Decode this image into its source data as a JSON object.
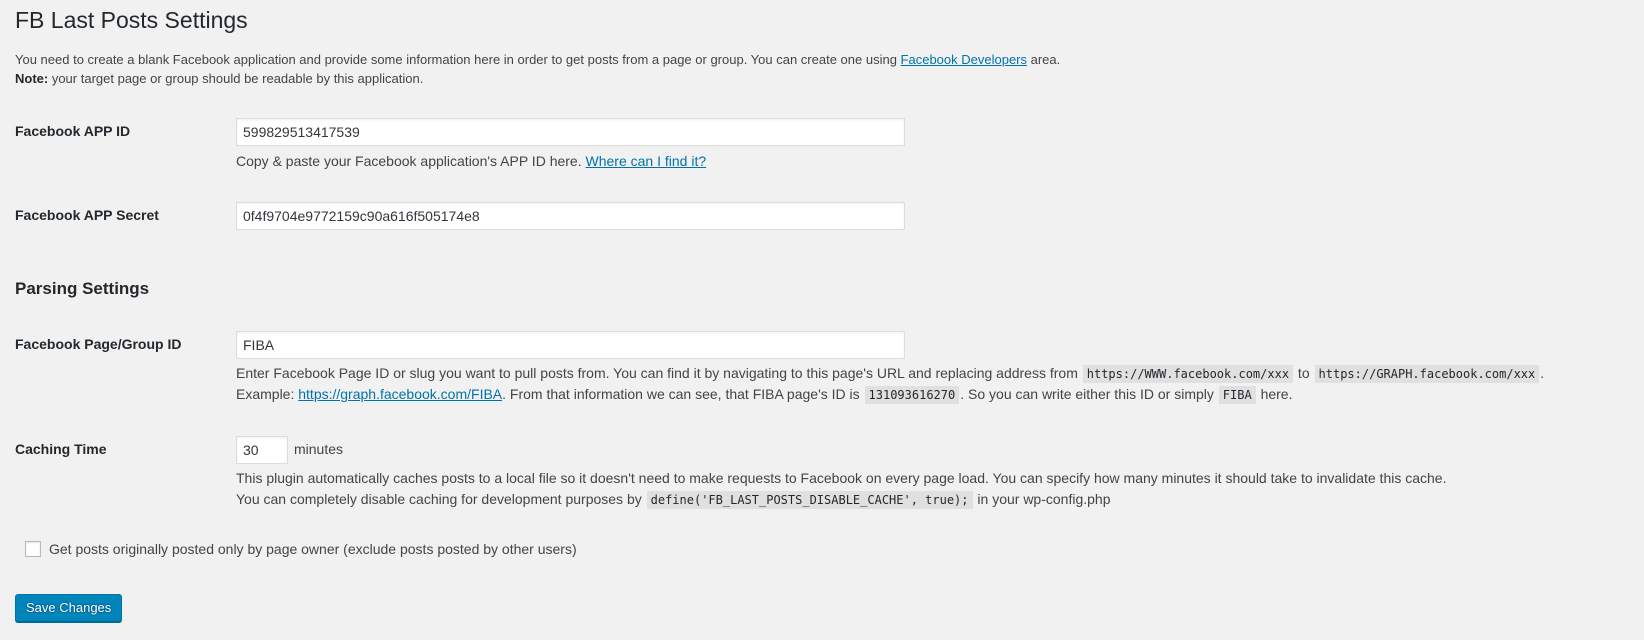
{
  "page": {
    "title": "FB Last Posts Settings"
  },
  "intro": {
    "line1_before": "You need to create a blank Facebook application and provide some information here in order to get posts from a page or group. You can create one using ",
    "line1_link": "Facebook Developers",
    "line1_after": " area.",
    "note_label": "Note:",
    "note_text": " your target page or group should be readable by this application."
  },
  "fields": {
    "app_id": {
      "label": "Facebook APP ID",
      "value": "599829513417539",
      "help_text": "Copy & paste your Facebook application's APP ID here. ",
      "help_link": "Where can I find it?"
    },
    "app_secret": {
      "label": "Facebook APP Secret",
      "value": "0f4f9704e9772159c90a616f505174e8"
    },
    "parsing_section_title": "Parsing Settings",
    "page_group_id": {
      "label": "Facebook Page/Group ID",
      "value": "FIBA",
      "desc1_before": "Enter Facebook Page ID or slug you want to pull posts from. You can find it by navigating to this page's URL and replacing address from ",
      "desc1_code1": "https://WWW.facebook.com/xxx",
      "desc1_mid": " to ",
      "desc1_code2": "https://GRAPH.facebook.com/xxx",
      "desc1_end": ".",
      "desc2_before": "Example: ",
      "desc2_link": "https://graph.facebook.com/FIBA",
      "desc2_mid": ". From that information we can see, that FIBA page's ID is ",
      "desc2_code1": "131093616270",
      "desc2_mid2": ". So you can write either this ID or simply ",
      "desc2_code2": "FIBA",
      "desc2_end": " here."
    },
    "caching_time": {
      "label": "Caching Time",
      "value": "30",
      "unit": "minutes",
      "desc1": "This plugin automatically caches posts to a local file so it doesn't need to make requests to Facebook on every page load. You can specify how many minutes it should take to invalidate this cache.",
      "desc2_before": "You can completely disable caching for development purposes by ",
      "desc2_code": "define('FB_LAST_POSTS_DISABLE_CACHE', true);",
      "desc2_after": " in your wp-config.php"
    },
    "owner_only": {
      "label": "Get posts originally posted only by page owner (exclude posts posted by other users)",
      "checked": false
    }
  },
  "actions": {
    "save_label": "Save Changes"
  },
  "colors": {
    "background": "#f1f1f1",
    "link": "#0073aa",
    "primary_button": "#0085ba"
  }
}
